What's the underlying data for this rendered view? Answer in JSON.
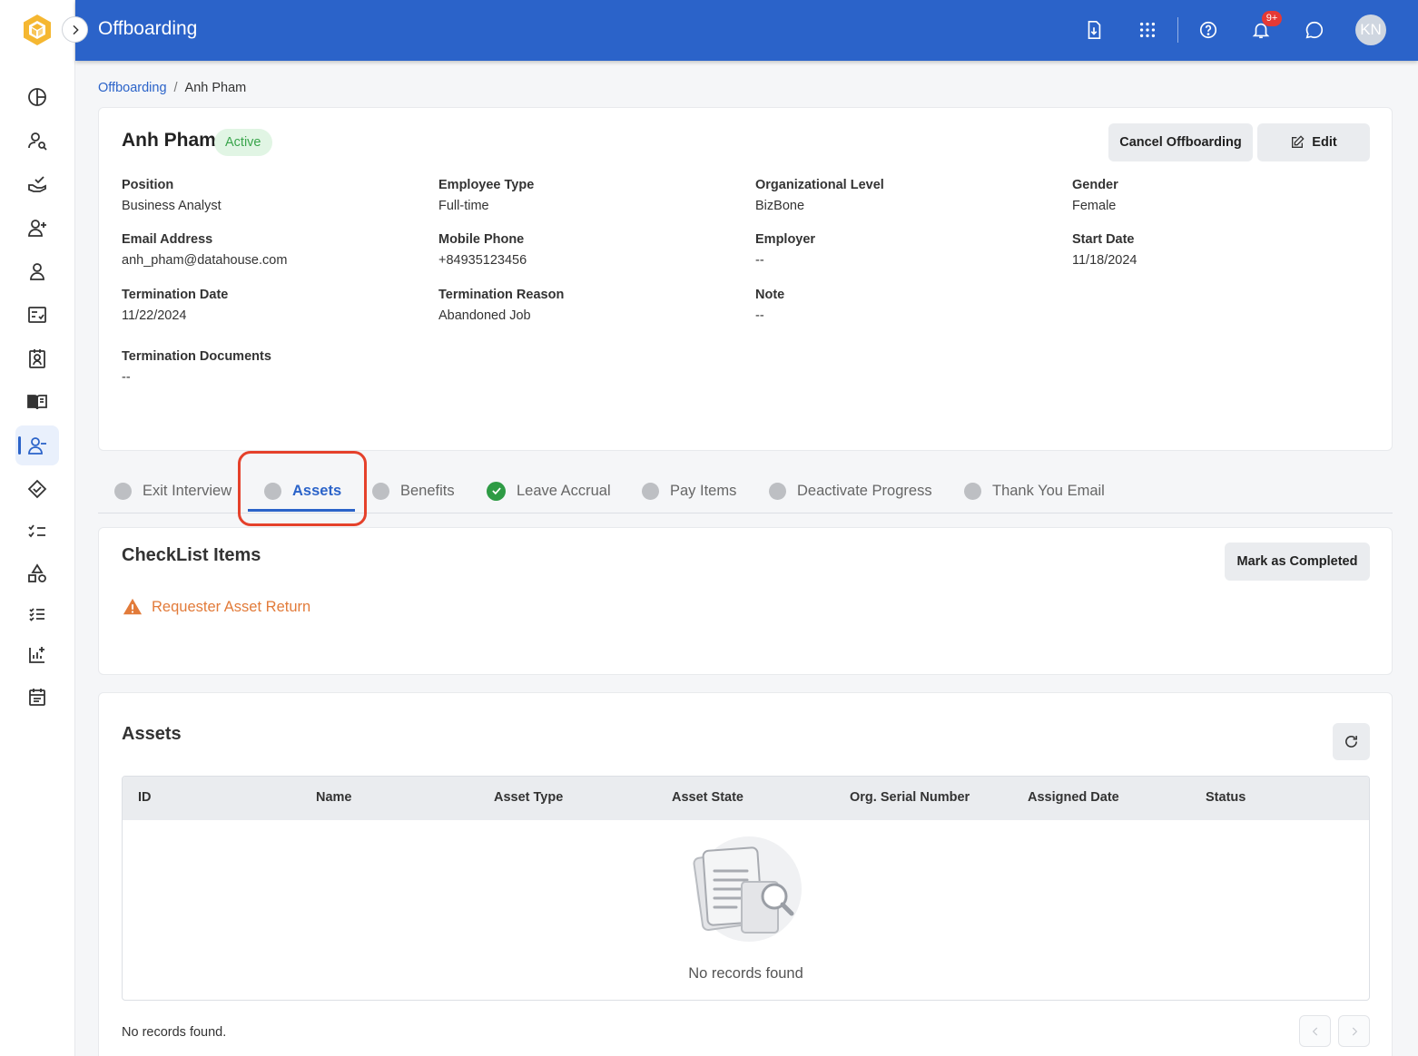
{
  "colors": {
    "header_bg": "#2b63c9",
    "accent": "#2b63c9",
    "active_badge_bg": "#e1f5e4",
    "active_badge_text": "#3aa54c",
    "warning": "#e27b3a",
    "highlight": "#e5412b",
    "success": "#2e9b45"
  },
  "header": {
    "title": "Offboarding",
    "icons": [
      "download-icon",
      "apps-grid-icon",
      "help-icon",
      "bell-icon",
      "chat-icon"
    ],
    "notification_count": "9+",
    "avatar_initials": "KN"
  },
  "sidebar": {
    "items": [
      {
        "icon": "dashboard-icon",
        "active": false
      },
      {
        "icon": "user-search-icon",
        "active": false
      },
      {
        "icon": "hand-check-icon",
        "active": false
      },
      {
        "icon": "user-add-icon",
        "active": false
      },
      {
        "icon": "user-icon",
        "active": false
      },
      {
        "icon": "checklist-icon",
        "active": false
      },
      {
        "icon": "contact-card-icon",
        "active": false
      },
      {
        "icon": "book-icon",
        "active": false
      },
      {
        "icon": "user-remove-icon",
        "active": true
      },
      {
        "icon": "handshake-icon",
        "active": false
      },
      {
        "icon": "task-list-icon",
        "active": false
      },
      {
        "icon": "shapes-icon",
        "active": false
      },
      {
        "icon": "list-check-icon",
        "active": false
      },
      {
        "icon": "report-add-icon",
        "active": false
      },
      {
        "icon": "calendar-icon",
        "active": false
      }
    ]
  },
  "breadcrumb": {
    "parent": "Offboarding",
    "separator": "/",
    "current": "Anh Pham"
  },
  "employee": {
    "name": "Anh Pham",
    "status": "Active",
    "cancel_label": "Cancel Offboarding",
    "edit_label": "Edit",
    "fields": [
      {
        "label": "Position",
        "value": "Business Analyst"
      },
      {
        "label": "Employee Type",
        "value": "Full-time"
      },
      {
        "label": "Organizational Level",
        "value": "BizBone"
      },
      {
        "label": "Gender",
        "value": "Female"
      },
      {
        "label": "Email Address",
        "value": "anh_pham@datahouse.com"
      },
      {
        "label": "Mobile Phone",
        "value": "+84935123456"
      },
      {
        "label": "Employer",
        "value": "--"
      },
      {
        "label": "Start Date",
        "value": "11/18/2024"
      },
      {
        "label": "Termination Date",
        "value": "11/22/2024"
      },
      {
        "label": "Termination Reason",
        "value": "Abandoned Job"
      },
      {
        "label": "Note",
        "value": "--"
      },
      {
        "label": "Termination Documents",
        "value": "--"
      }
    ]
  },
  "tabs": [
    {
      "label": "Exit Interview",
      "state": "pending",
      "active": false
    },
    {
      "label": "Assets",
      "state": "pending",
      "active": true
    },
    {
      "label": "Benefits",
      "state": "pending",
      "active": false
    },
    {
      "label": "Leave Accrual",
      "state": "completed",
      "active": false
    },
    {
      "label": "Pay Items",
      "state": "pending",
      "active": false
    },
    {
      "label": "Deactivate Progress",
      "state": "pending",
      "active": false
    },
    {
      "label": "Thank You Email",
      "state": "pending",
      "active": false
    }
  ],
  "checklist": {
    "title": "CheckList Items",
    "button_label": "Mark as Completed",
    "item": "Requester Asset Return"
  },
  "assets": {
    "title": "Assets",
    "columns": [
      "ID",
      "Name",
      "Asset Type",
      "Asset State",
      "Org. Serial Number",
      "Assigned Date",
      "Status"
    ],
    "rows": [],
    "empty_text": "No records found",
    "footer_text": "No records found."
  }
}
